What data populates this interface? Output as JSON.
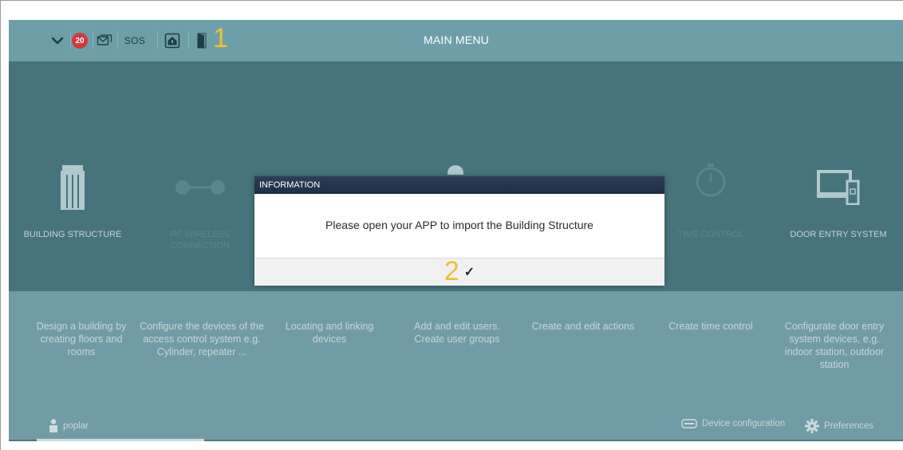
{
  "topbar": {
    "title": "MAIN MENU",
    "notification_count": "20",
    "sos_label": "SOS",
    "marker_1": "1",
    "icons": [
      "chevron-down-icon",
      "notification-badge",
      "message-icon",
      "sos-button",
      "home-alarm-icon",
      "door-icon"
    ]
  },
  "tiles": [
    {
      "label": "BUILDING STRUCTURE",
      "icon": "building-icon",
      "state": "visible"
    },
    {
      "label": "RF WIRELESS CONNECTION",
      "icon": "connection-icon",
      "state": "dim"
    },
    {
      "label": "",
      "icon": "map-icon",
      "state": "covered"
    },
    {
      "label": "",
      "icon": "user-icon",
      "state": "covered"
    },
    {
      "label": "",
      "icon": "actions-icon",
      "state": "covered"
    },
    {
      "label": "TIME CONTROL",
      "icon": "stopwatch-icon",
      "state": "dim"
    },
    {
      "label": "DOOR ENTRY SYSTEM",
      "icon": "door-entry-icon",
      "state": "visible"
    }
  ],
  "descriptions": [
    "Design a building by creating floors and rooms",
    "Configure the devices of the access control system e.g. Cylinder, repeater ...",
    "Locating and linking devices",
    "Add and edit users. Create user groups",
    "Create and edit actions",
    "Create time control",
    "Configurate door entry system devices, e.g. indoor station, outdoor station"
  ],
  "bottombar": {
    "user_name": "poplar",
    "device_config_label": "Device configuration",
    "preferences_label": "Preferences"
  },
  "dialog": {
    "title": "INFORMATION",
    "message": "Please open your APP to import the Building Structure",
    "marker_2": "2",
    "ok_label": "✓"
  },
  "colors": {
    "band": "#245862",
    "background": "#6a9aa3",
    "badge": "#d23a3a",
    "marker": "#f0c12e",
    "dialog_header": "#1e2f44"
  }
}
